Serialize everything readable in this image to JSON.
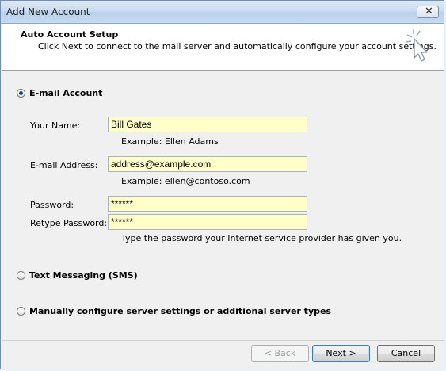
{
  "window": {
    "title": "Add New Account",
    "close_label": "✕"
  },
  "header": {
    "title": "Auto Account Setup",
    "subtitle": "Click Next to connect to the mail server and automatically configure your account settings.",
    "icon": "cursor-sparkle-icon"
  },
  "options": {
    "email_account": {
      "label": "E-mail Account",
      "selected": true
    },
    "text_messaging": {
      "label": "Text Messaging (SMS)",
      "selected": false
    },
    "manual": {
      "label": "Manually configure server settings or additional server types",
      "selected": false
    }
  },
  "form": {
    "name_label": "Your Name:",
    "name_value": "Bill Gates",
    "name_hint": "Example: Ellen Adams",
    "email_label": "E-mail Address:",
    "email_value": "address@example.com",
    "email_hint": "Example: ellen@contoso.com",
    "password_label": "Password:",
    "password_value": "******",
    "retype_label": "Retype Password:",
    "retype_value": "******",
    "password_hint": "Type the password your Internet service provider has given you."
  },
  "footer": {
    "back_label": "< Back",
    "next_label": "Next >",
    "cancel_label": "Cancel"
  },
  "colors": {
    "field_bg": "#ffffc7",
    "header_bg": "#ffffff",
    "dialog_bg": "#f0f0f0"
  }
}
